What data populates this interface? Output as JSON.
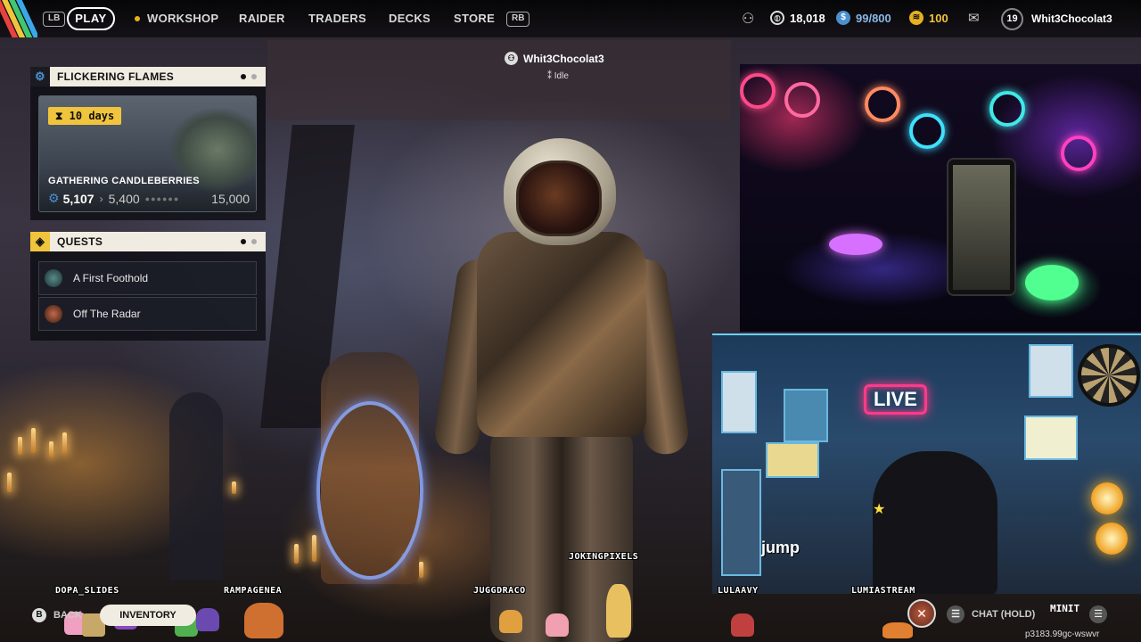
{
  "nav": {
    "lb": "LB",
    "rb": "RB",
    "play": "PLAY",
    "items": [
      "WORKSHOP",
      "RAIDER",
      "TRADERS",
      "DECKS",
      "STORE"
    ]
  },
  "stats": {
    "coins": "18,018",
    "tokens": "99/800",
    "credits": "100",
    "level": "19",
    "username": "Whit3Chocolat3"
  },
  "event_panel": {
    "title": "FLICKERING FLAMES",
    "days": "10 days",
    "card_title": "GATHERING CANDLEBERRIES",
    "current": "5,107",
    "next": "5,400",
    "max": "15,000"
  },
  "quests_panel": {
    "title": "QUESTS",
    "items": [
      {
        "label": "A First Foothold"
      },
      {
        "label": "Off The Radar"
      }
    ]
  },
  "player": {
    "name": "Whit3Chocolat3",
    "status": "Idle"
  },
  "overlay": {
    "live_sign": "LIVE",
    "chat_names": [
      "DOPA_SLIDES",
      "RAMPAGENEA",
      "JOKINGPIXELS",
      "JUGGDRACO",
      "LULAAVY",
      "LUMIASTREAM",
      "MINIT"
    ],
    "jump_text": "jump"
  },
  "bottom": {
    "back_key": "B",
    "back": "BACK",
    "inventory": "INVENTORY",
    "chat_hold": "CHAT (HOLD)",
    "session_id": "p3183.99gc-wswvr"
  },
  "colors": {
    "accent_gold": "#f0c43c",
    "panel_header": "#f1ece1",
    "live_pink": "#ff3a8a"
  }
}
